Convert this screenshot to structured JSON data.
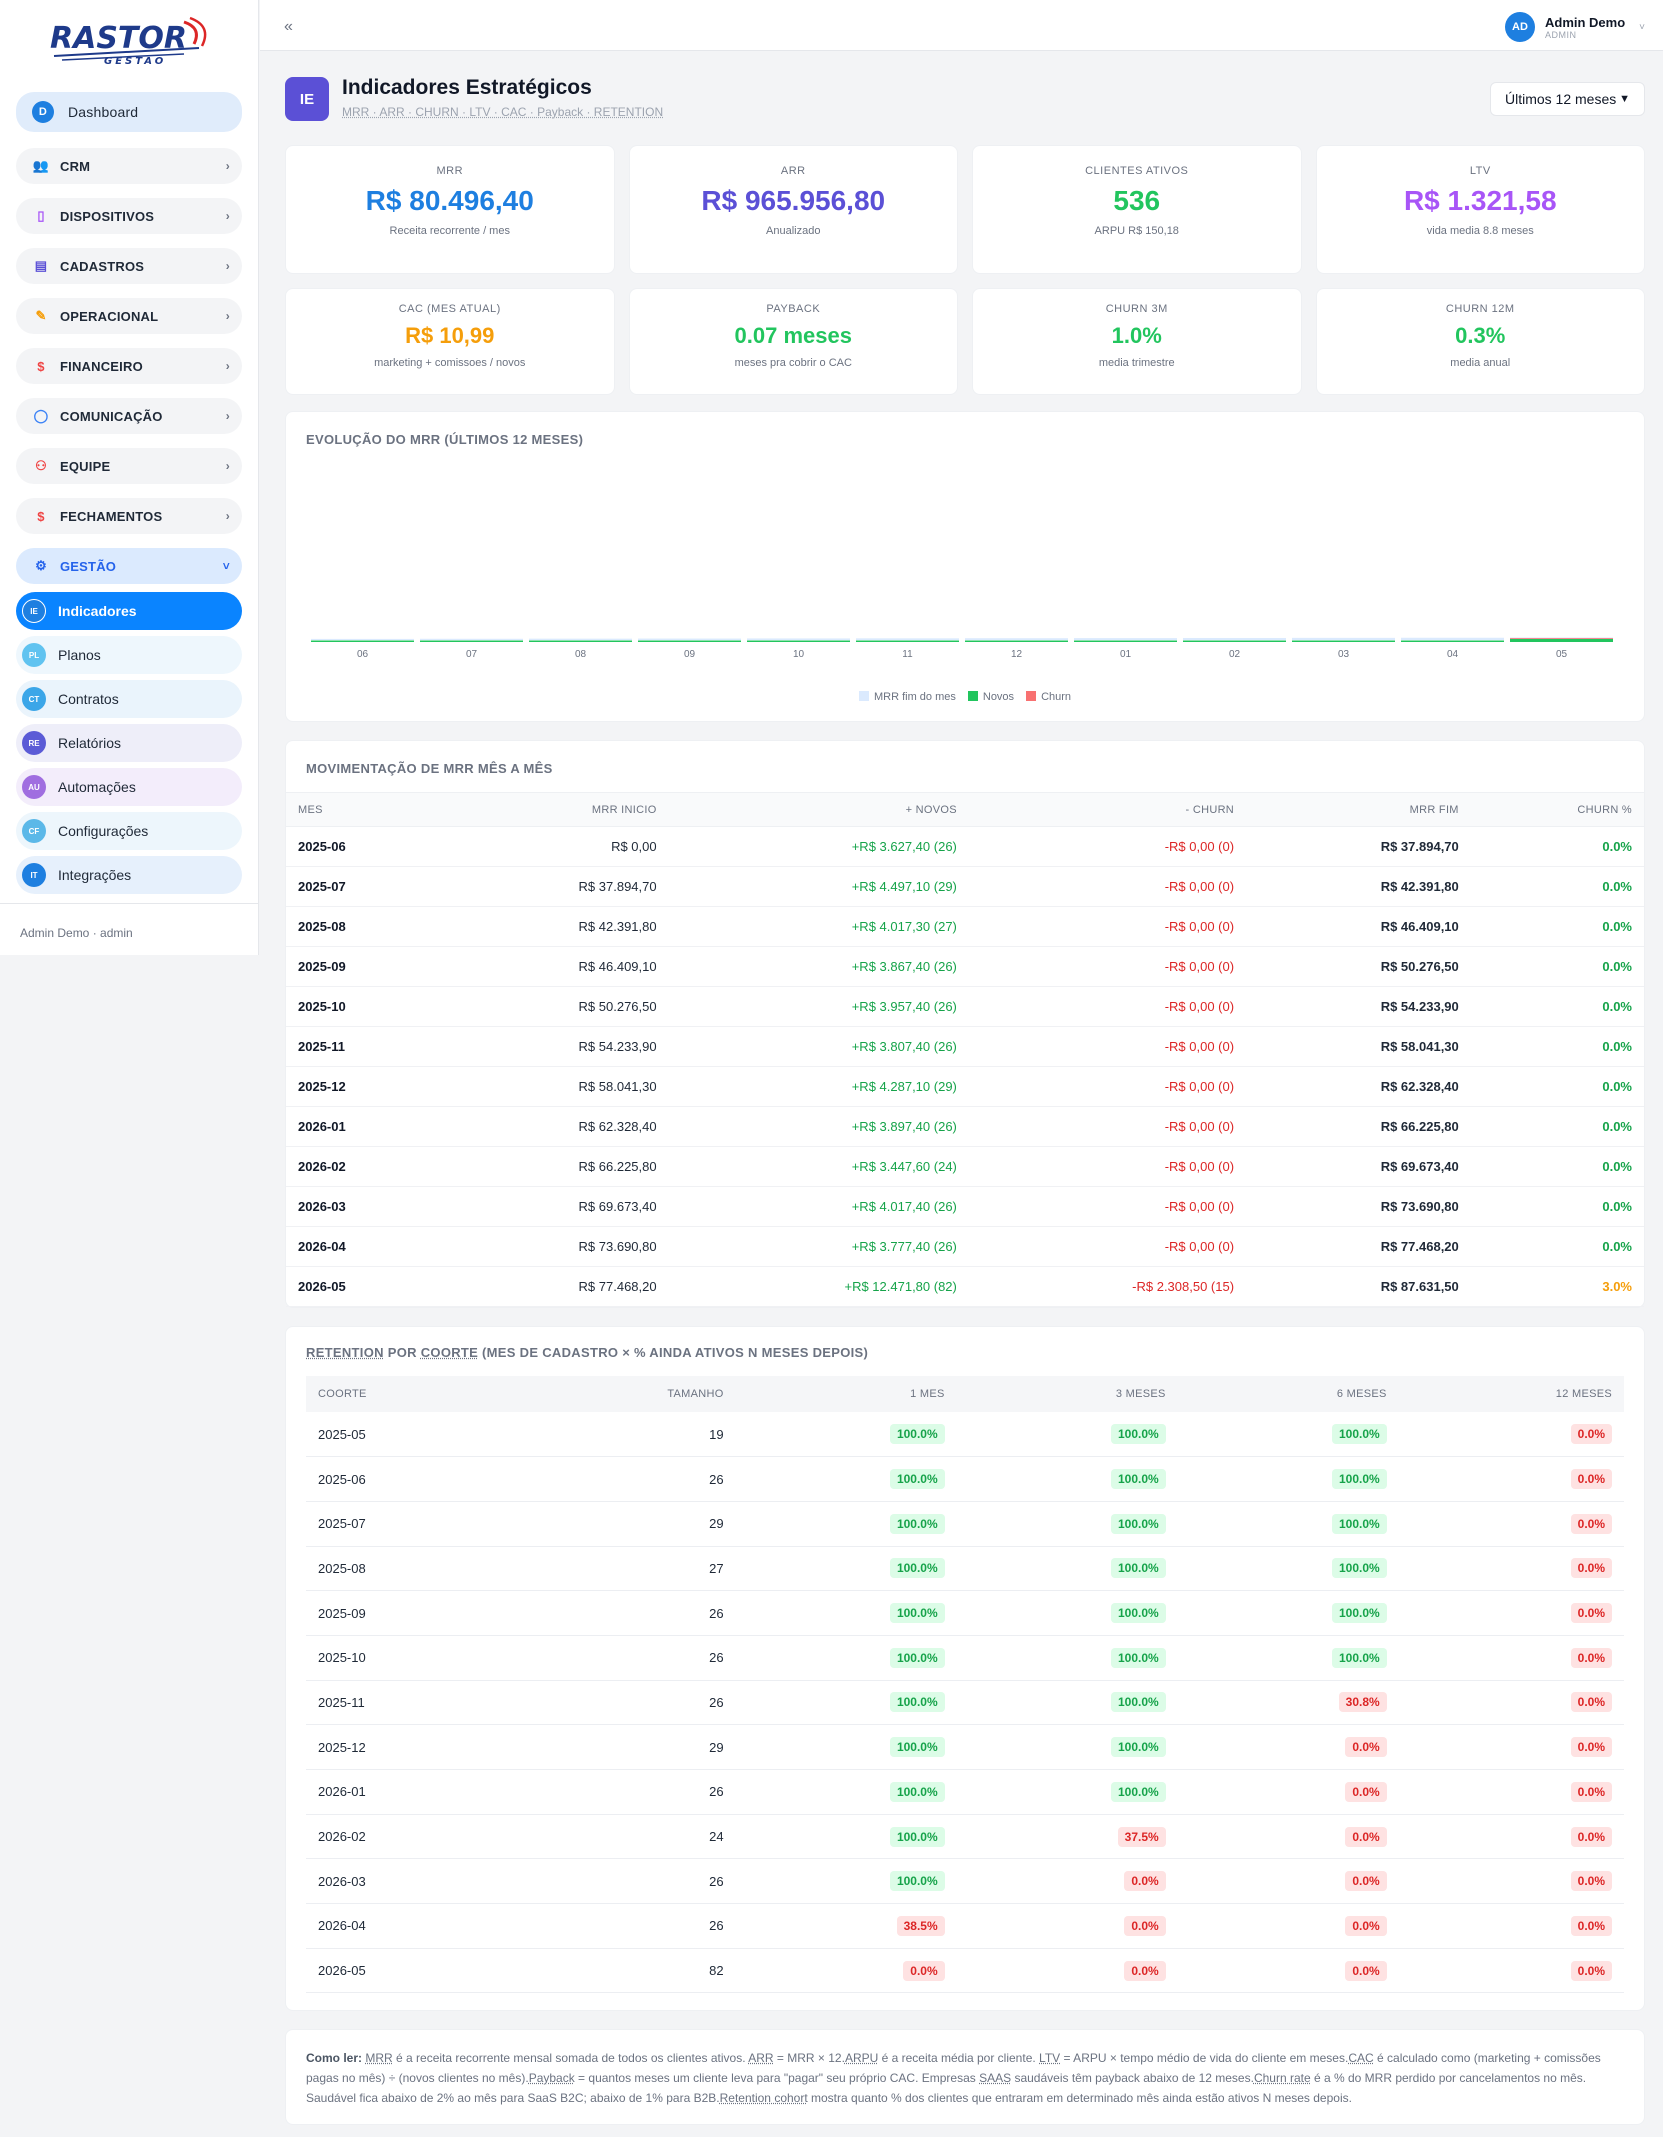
{
  "brand": {
    "logo_text": "RASTOR",
    "logo_sub": "GESTÃO"
  },
  "sidebar": {
    "dashboard": {
      "badge": "D",
      "label": "Dashboard"
    },
    "sections": [
      {
        "label": "CRM",
        "icon": "users-icon"
      },
      {
        "label": "DISPOSITIVOS",
        "icon": "phone-icon"
      },
      {
        "label": "CADASTROS",
        "icon": "table-icon"
      },
      {
        "label": "OPERACIONAL",
        "icon": "pencil-icon"
      },
      {
        "label": "FINANCEIRO",
        "icon": "dollar-icon"
      },
      {
        "label": "COMUNICAÇÃO",
        "icon": "chat-icon"
      },
      {
        "label": "EQUIPE",
        "icon": "person-icon"
      },
      {
        "label": "FECHAMENTOS",
        "icon": "dollar-icon"
      }
    ],
    "gestao": {
      "label": "GESTÃO",
      "icon": "gear-icon"
    },
    "subitems": [
      {
        "badge": "IE",
        "label": "Indicadores",
        "color": "#1e7fe0",
        "bg": "#0a84ff"
      },
      {
        "badge": "PL",
        "label": "Planos",
        "color": "#60c3f0",
        "bg": "#eef7fd"
      },
      {
        "badge": "CT",
        "label": "Contratos",
        "color": "#3ba6e8",
        "bg": "#eaf4fc"
      },
      {
        "badge": "RE",
        "label": "Relatórios",
        "color": "#5b5bd6",
        "bg": "#eeeef9"
      },
      {
        "badge": "AU",
        "label": "Automações",
        "color": "#a06ee0",
        "bg": "#f3edfb"
      },
      {
        "badge": "CF",
        "label": "Configurações",
        "color": "#5bb8e8",
        "bg": "#edf6fc"
      },
      {
        "badge": "IT",
        "label": "Integrações",
        "color": "#1e7fe0",
        "bg": "#e6f0fc"
      }
    ],
    "footer": "Admin Demo · admin"
  },
  "topbar": {
    "collapse": "«",
    "avatar": "AD",
    "user_name": "Admin Demo",
    "user_role": "ADMIN"
  },
  "page": {
    "badge": "IE",
    "title": "Indicadores Estratégicos",
    "subtitle": "MRR · ARR · CHURN · LTV · CAC · Payback · RETENTION",
    "period": "Últimos 12 meses"
  },
  "kpis": [
    {
      "label": "MRR",
      "value": "R$ 80.496,40",
      "note": "Receita recorrente / mes",
      "color": "#1e7fe0"
    },
    {
      "label": "ARR",
      "value": "R$ 965.956,80",
      "note": "Anualizado",
      "color": "#5b50d6"
    },
    {
      "label": "CLIENTES ATIVOS",
      "value": "536",
      "note": "ARPU R$ 150,18",
      "color": "#22c55e"
    },
    {
      "label": "LTV",
      "value": "R$ 1.321,58",
      "note": "vida media 8.8 meses",
      "color": "#a855f7"
    },
    {
      "label": "CAC (MES ATUAL)",
      "value": "R$ 10,99",
      "note": "marketing + comissoes / novos",
      "color": "#f59e0b"
    },
    {
      "label": "PAYBACK",
      "value": "0.07 meses",
      "note": "meses pra cobrir o CAC",
      "color": "#22c55e"
    },
    {
      "label": "CHURN 3M",
      "value": "1.0%",
      "note": "media trimestre",
      "color": "#22c55e"
    },
    {
      "label": "CHURN 12M",
      "value": "0.3%",
      "note": "media anual",
      "color": "#22c55e"
    }
  ],
  "chart_title": "EVOLUÇÃO DO MRR (ÚLTIMOS 12 MESES)",
  "chart_data": {
    "type": "bar",
    "categories": [
      "06",
      "07",
      "08",
      "09",
      "10",
      "11",
      "12",
      "01",
      "02",
      "03",
      "04",
      "05"
    ],
    "series": [
      {
        "name": "MRR fim do mes",
        "values": [
          37894.7,
          42391.8,
          46409.1,
          50276.5,
          54233.9,
          58041.3,
          62328.4,
          66225.8,
          69673.4,
          73690.8,
          77468.2,
          87631.5
        ],
        "color": "#dbeafe"
      },
      {
        "name": "Novos",
        "values": [
          3627.4,
          4497.1,
          4017.3,
          3867.4,
          3957.4,
          3807.4,
          4287.1,
          3897.4,
          3447.6,
          4017.3,
          3777.4,
          12471.8
        ],
        "color": "#22c55e"
      },
      {
        "name": "Churn",
        "values": [
          0,
          0,
          0,
          0,
          0,
          0,
          0,
          0,
          0,
          0,
          0,
          2308.5
        ],
        "color": "#f87171"
      }
    ],
    "grid": false,
    "legend": "bottom"
  },
  "movement": {
    "title": "MOVIMENTAÇÃO DE MRR MÊS A MÊS",
    "headers": [
      "MES",
      "MRR INICIO",
      "+ NOVOS",
      "- CHURN",
      "MRR FIM",
      "CHURN %"
    ],
    "rows": [
      [
        "2025-06",
        "R$ 0,00",
        "+R$ 3.627,40 (26)",
        "-R$ 0,00 (0)",
        "R$ 37.894,70",
        "0.0%"
      ],
      [
        "2025-07",
        "R$ 37.894,70",
        "+R$ 4.497,10 (29)",
        "-R$ 0,00 (0)",
        "R$ 42.391,80",
        "0.0%"
      ],
      [
        "2025-08",
        "R$ 42.391,80",
        "+R$ 4.017,30 (27)",
        "-R$ 0,00 (0)",
        "R$ 46.409,10",
        "0.0%"
      ],
      [
        "2025-09",
        "R$ 46.409,10",
        "+R$ 3.867,40 (26)",
        "-R$ 0,00 (0)",
        "R$ 50.276,50",
        "0.0%"
      ],
      [
        "2025-10",
        "R$ 50.276,50",
        "+R$ 3.957,40 (26)",
        "-R$ 0,00 (0)",
        "R$ 54.233,90",
        "0.0%"
      ],
      [
        "2025-11",
        "R$ 54.233,90",
        "+R$ 3.807,40 (26)",
        "-R$ 0,00 (0)",
        "R$ 58.041,30",
        "0.0%"
      ],
      [
        "2025-12",
        "R$ 58.041,30",
        "+R$ 4.287,10 (29)",
        "-R$ 0,00 (0)",
        "R$ 62.328,40",
        "0.0%"
      ],
      [
        "2026-01",
        "R$ 62.328,40",
        "+R$ 3.897,40 (26)",
        "-R$ 0,00 (0)",
        "R$ 66.225,80",
        "0.0%"
      ],
      [
        "2026-02",
        "R$ 66.225,80",
        "+R$ 3.447,60 (24)",
        "-R$ 0,00 (0)",
        "R$ 69.673,40",
        "0.0%"
      ],
      [
        "2026-03",
        "R$ 69.673,40",
        "+R$ 4.017,40 (26)",
        "-R$ 0,00 (0)",
        "R$ 73.690,80",
        "0.0%"
      ],
      [
        "2026-04",
        "R$ 73.690,80",
        "+R$ 3.777,40 (26)",
        "-R$ 0,00 (0)",
        "R$ 77.468,20",
        "0.0%"
      ],
      [
        "2026-05",
        "R$ 77.468,20",
        "+R$ 12.471,80 (82)",
        "-R$ 2.308,50 (15)",
        "R$ 87.631,50",
        "3.0%"
      ]
    ]
  },
  "retention": {
    "title_a": "RETENTION",
    "title_b": " POR ",
    "title_c": "COORTE",
    "title_d": " (MES DE CADASTRO × % AINDA ATIVOS N MESES DEPOIS)",
    "headers": [
      "COORTE",
      "TAMANHO",
      "1 MES",
      "3 MESES",
      "6 MESES",
      "12 MESES"
    ],
    "rows": [
      [
        "2025-05",
        "19",
        "100.0%",
        "100.0%",
        "100.0%",
        "0.0%"
      ],
      [
        "2025-06",
        "26",
        "100.0%",
        "100.0%",
        "100.0%",
        "0.0%"
      ],
      [
        "2025-07",
        "29",
        "100.0%",
        "100.0%",
        "100.0%",
        "0.0%"
      ],
      [
        "2025-08",
        "27",
        "100.0%",
        "100.0%",
        "100.0%",
        "0.0%"
      ],
      [
        "2025-09",
        "26",
        "100.0%",
        "100.0%",
        "100.0%",
        "0.0%"
      ],
      [
        "2025-10",
        "26",
        "100.0%",
        "100.0%",
        "100.0%",
        "0.0%"
      ],
      [
        "2025-11",
        "26",
        "100.0%",
        "100.0%",
        "30.8%",
        "0.0%"
      ],
      [
        "2025-12",
        "29",
        "100.0%",
        "100.0%",
        "0.0%",
        "0.0%"
      ],
      [
        "2026-01",
        "26",
        "100.0%",
        "100.0%",
        "0.0%",
        "0.0%"
      ],
      [
        "2026-02",
        "24",
        "100.0%",
        "37.5%",
        "0.0%",
        "0.0%"
      ],
      [
        "2026-03",
        "26",
        "100.0%",
        "0.0%",
        "0.0%",
        "0.0%"
      ],
      [
        "2026-04",
        "26",
        "38.5%",
        "0.0%",
        "0.0%",
        "0.0%"
      ],
      [
        "2026-05",
        "82",
        "0.0%",
        "0.0%",
        "0.0%",
        "0.0%"
      ]
    ]
  },
  "note": {
    "lead": "Como ler:",
    "p1": "MRR",
    "t1": " é a receita recorrente mensal somada de todos os clientes ativos. ",
    "p2": "ARR",
    "t2": " = MRR × 12.",
    "p3": "ARPU",
    "t3": " é a receita média por cliente. ",
    "p4": "LTV",
    "t4": " = ARPU × tempo médio de vida do cliente em meses.",
    "p5": "CAC",
    "t5": " é calculado como (marketing + comissões pagas no mês) ÷ (novos clientes no mês).",
    "p6": "Payback",
    "t6": " = quantos meses um cliente leva para \"pagar\" seu próprio CAC. Empresas ",
    "p7": "SAAS",
    "t7": " saudáveis têm payback abaixo de 12 meses.",
    "p8": "Churn rate",
    "t8": " é a % do MRR perdido por cancelamentos no mês. Saudável fica abaixo de 2% ao mês para SaaS B2C; abaixo de 1% para B2B.",
    "p9": "Retention cohort",
    "t9": " mostra quanto % dos clientes que entraram em determinado mês ainda estão ativos N meses depois."
  }
}
